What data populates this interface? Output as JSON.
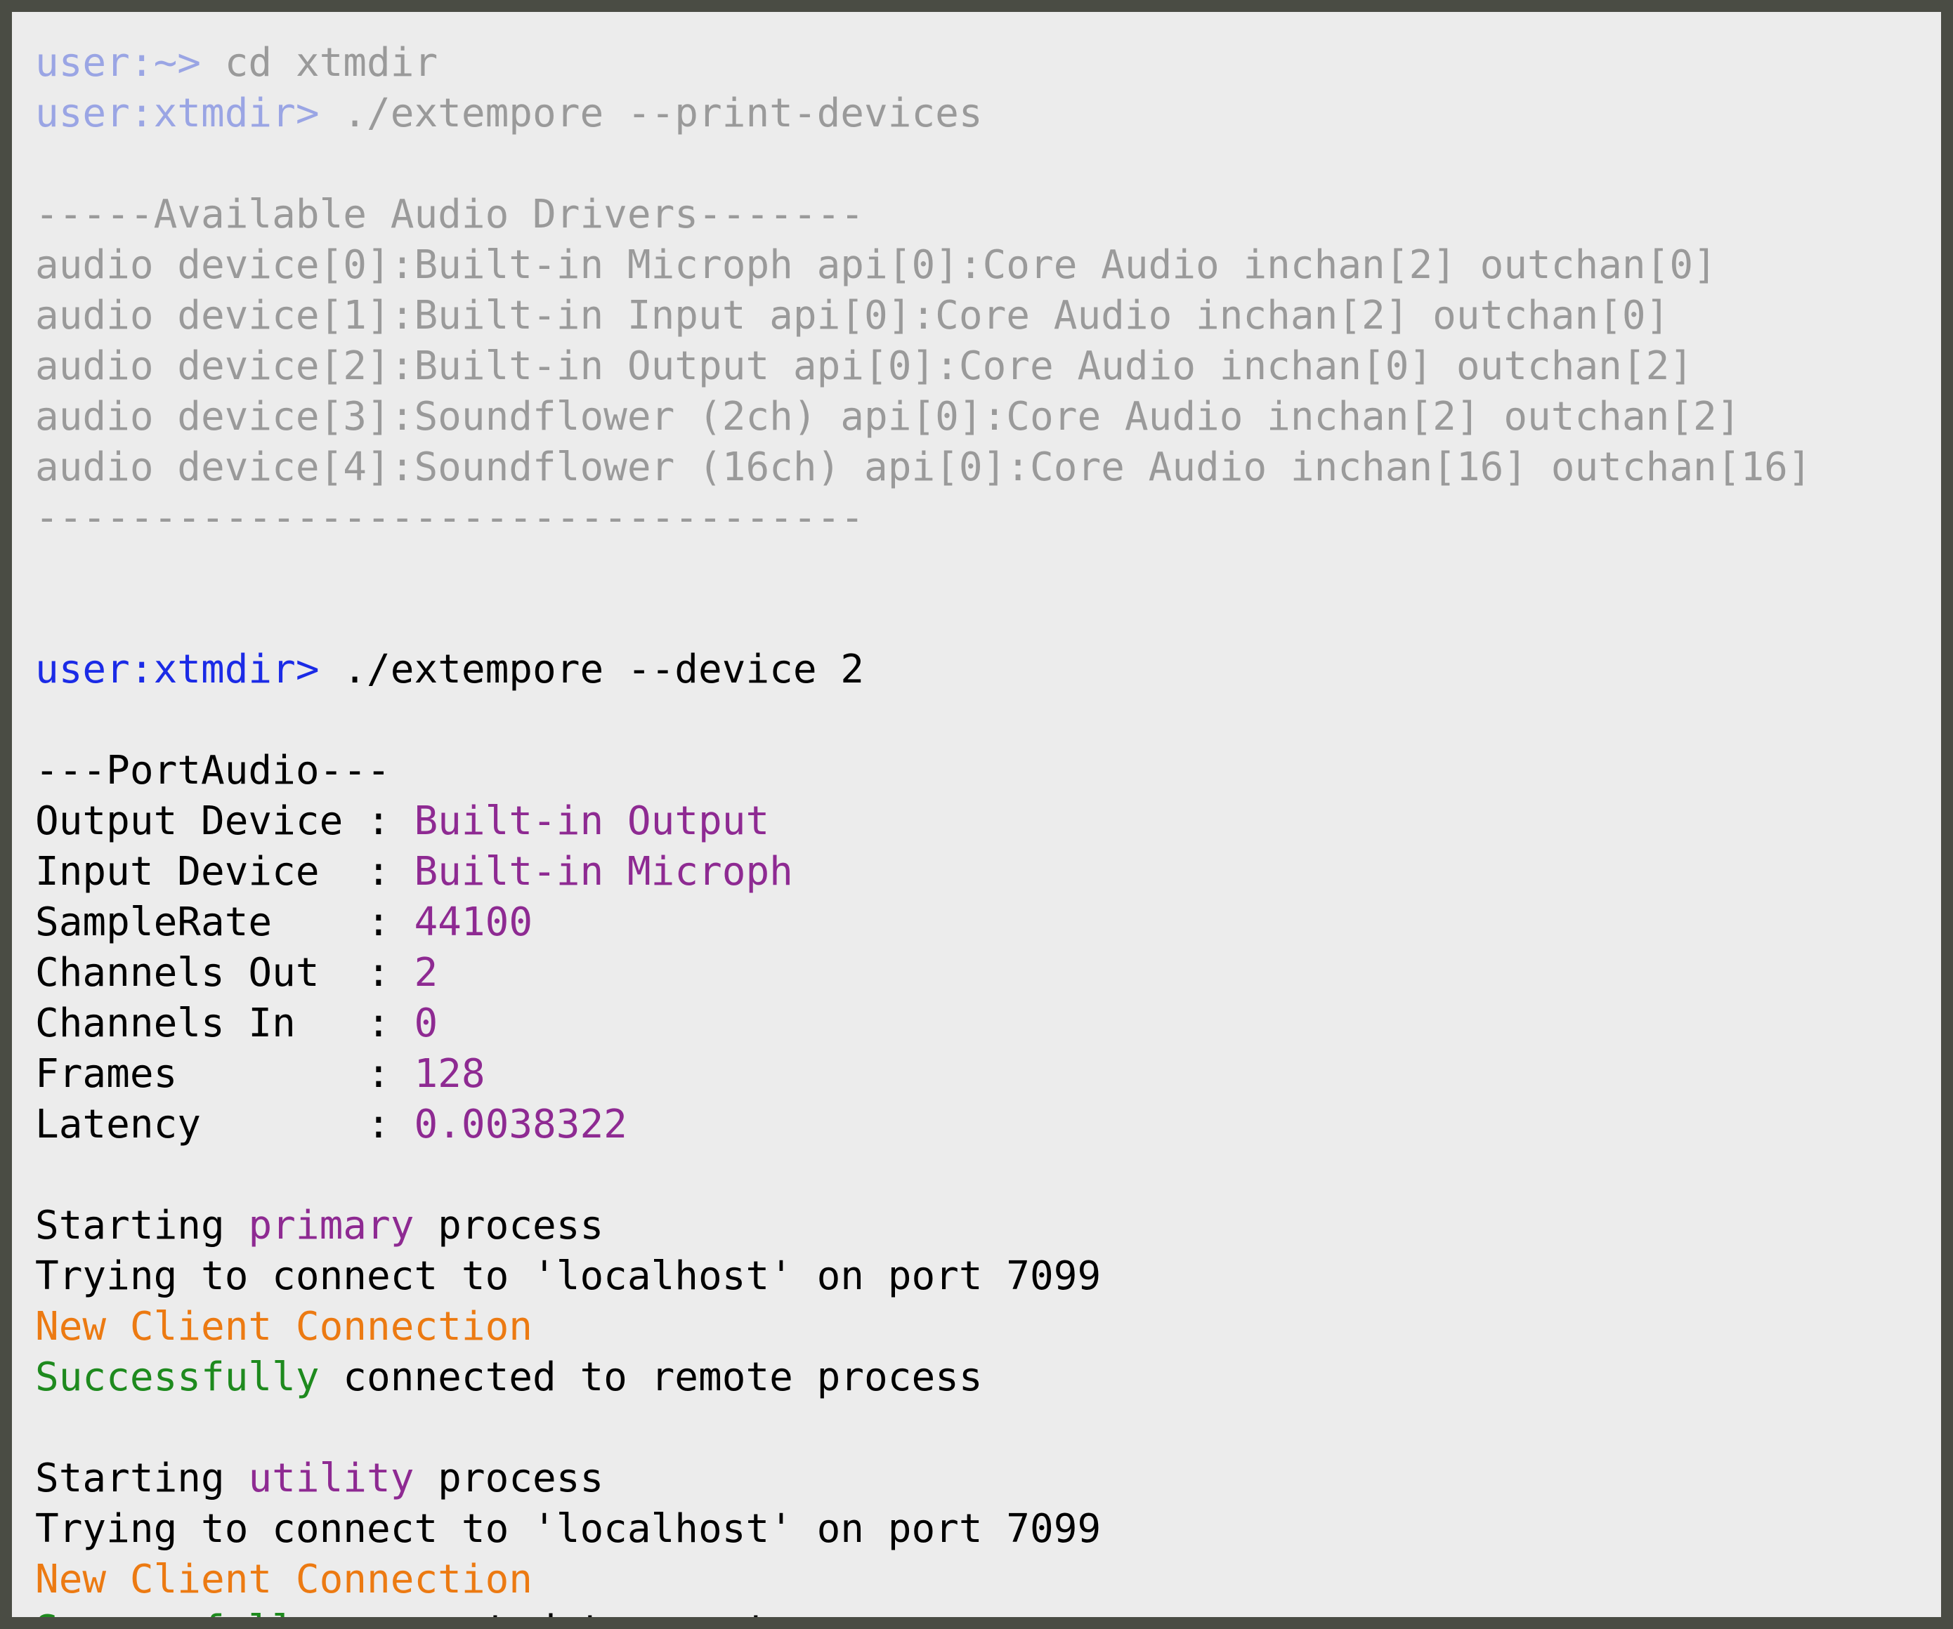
{
  "colors": {
    "frame": "#4a4c44",
    "background": "#ececec",
    "dim_text": "#9a9a9a",
    "dim_prompt": "#9aa5e4",
    "prompt": "#1b2be6",
    "value": "#8e2a92",
    "notice": "#ec7a12",
    "success": "#1e8a1e"
  },
  "session1": {
    "line1": {
      "prompt": "user:~> ",
      "command": "cd xtmdir"
    },
    "line2": {
      "prompt": "user:xtmdir> ",
      "command": "./extempore --print-devices"
    },
    "header": "-----Available Audio Drivers-------",
    "devices": [
      "audio device[0]:Built-in Microph api[0]:Core Audio inchan[2] outchan[0]",
      "audio device[1]:Built-in Input api[0]:Core Audio inchan[2] outchan[0]",
      "audio device[2]:Built-in Output api[0]:Core Audio inchan[0] outchan[2]",
      "audio device[3]:Soundflower (2ch) api[0]:Core Audio inchan[2] outchan[2]",
      "audio device[4]:Soundflower (16ch) api[0]:Core Audio inchan[16] outchan[16]"
    ],
    "footer": "-----------------------------------"
  },
  "session2": {
    "prompt": "user:xtmdir> ",
    "command": "./extempore --device 2",
    "portaudio_header": "---PortAudio---",
    "settings": [
      {
        "key": "Output Device ",
        "sep": ": ",
        "value": "Built-in Output"
      },
      {
        "key": "Input Device  ",
        "sep": ": ",
        "value": "Built-in Microph"
      },
      {
        "key": "SampleRate    ",
        "sep": ": ",
        "value": "44100"
      },
      {
        "key": "Channels Out  ",
        "sep": ": ",
        "value": "2"
      },
      {
        "key": "Channels In   ",
        "sep": ": ",
        "value": "0"
      },
      {
        "key": "Frames        ",
        "sep": ": ",
        "value": "128"
      },
      {
        "key": "Latency       ",
        "sep": ": ",
        "value": "0.0038322"
      }
    ],
    "primary": {
      "start_prefix": "Starting ",
      "process_name": "primary",
      "start_suffix": " process",
      "connect": "Trying to connect to 'localhost' on port 7099",
      "new_client": "New Client Connection",
      "success_word": "Successfully",
      "success_rest": " connected to remote process"
    },
    "utility": {
      "start_prefix": "Starting ",
      "process_name": "utility",
      "start_suffix": " process",
      "connect": "Trying to connect to 'localhost' on port 7099",
      "new_client": "New Client Connection",
      "success_word": "Successfully",
      "success_rest": " connected to remote process"
    }
  }
}
